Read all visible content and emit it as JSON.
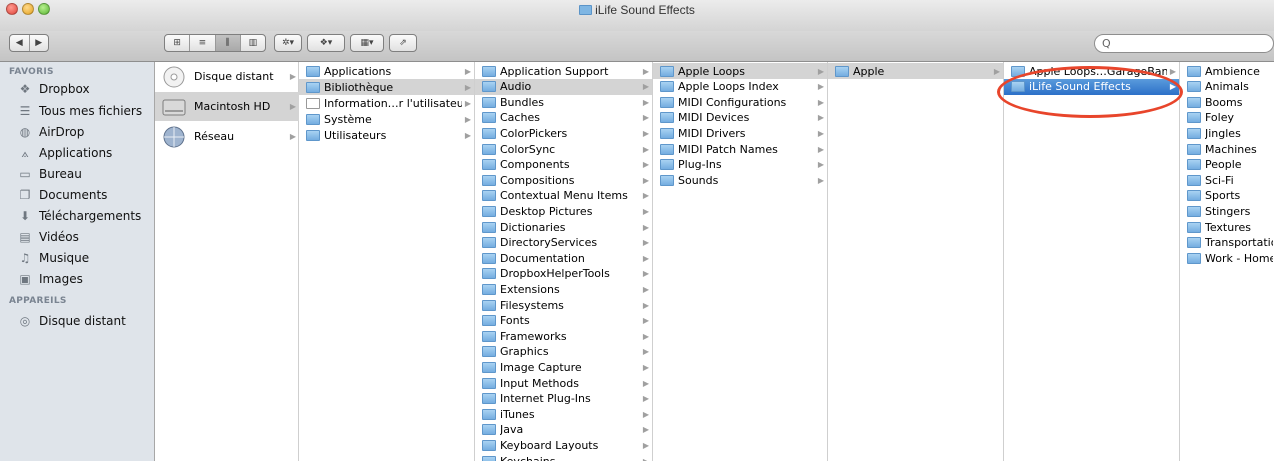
{
  "window": {
    "title": "iLife Sound Effects"
  },
  "toolbar": {
    "search_placeholder": "Q"
  },
  "sidebar": {
    "favorites_header": "FAVORIS",
    "favorites": [
      {
        "label": "Dropbox",
        "icon": "dropbox-icon"
      },
      {
        "label": "Tous mes fichiers",
        "icon": "all-files-icon"
      },
      {
        "label": "AirDrop",
        "icon": "airdrop-icon"
      },
      {
        "label": "Applications",
        "icon": "applications-icon"
      },
      {
        "label": "Bureau",
        "icon": "desktop-icon"
      },
      {
        "label": "Documents",
        "icon": "documents-icon"
      },
      {
        "label": "Téléchargements",
        "icon": "downloads-icon"
      },
      {
        "label": "Vidéos",
        "icon": "movies-icon"
      },
      {
        "label": "Musique",
        "icon": "music-icon"
      },
      {
        "label": "Images",
        "icon": "pictures-icon"
      }
    ],
    "devices_header": "APPAREILS",
    "devices": [
      {
        "label": "Disque distant",
        "icon": "remote-disc-icon"
      }
    ]
  },
  "columns": {
    "col1": [
      {
        "label": "Disque distant",
        "icon": "remote-disc-icon"
      },
      {
        "label": "Macintosh HD",
        "icon": "hard-drive-icon",
        "selected": true
      },
      {
        "label": "Réseau",
        "icon": "network-icon"
      }
    ],
    "col2": [
      {
        "label": "Applications"
      },
      {
        "label": "Bibliothèque",
        "selected": true
      },
      {
        "label": "Information…r l'utilisateur"
      },
      {
        "label": "Système"
      },
      {
        "label": "Utilisateurs"
      }
    ],
    "col3": [
      "Application Support",
      "Audio",
      "Bundles",
      "Caches",
      "ColorPickers",
      "ColorSync",
      "Components",
      "Compositions",
      "Contextual Menu Items",
      "Desktop Pictures",
      "Dictionaries",
      "DirectoryServices",
      "Documentation",
      "DropboxHelperTools",
      "Extensions",
      "Filesystems",
      "Fonts",
      "Frameworks",
      "Graphics",
      "Image Capture",
      "Input Methods",
      "Internet Plug-Ins",
      "iTunes",
      "Java",
      "Keyboard Layouts",
      "Keychains"
    ],
    "col3_selected": "Audio",
    "col4": [
      "Apple Loops",
      "Apple Loops Index",
      "MIDI Configurations",
      "MIDI Devices",
      "MIDI Drivers",
      "MIDI Patch Names",
      "Plug-Ins",
      "Sounds"
    ],
    "col4_selected": "Apple Loops",
    "col5": [
      "Apple"
    ],
    "col5_selected": "Apple",
    "col6": [
      "Apple Loops…GarageBand",
      "iLife Sound Effects"
    ],
    "col6_selected": "iLife Sound Effects",
    "col7": [
      "Ambience",
      "Animals",
      "Booms",
      "Foley",
      "Jingles",
      "Machines",
      "People",
      "Sci-Fi",
      "Sports",
      "Stingers",
      "Textures",
      "Transportation",
      "Work - Home"
    ]
  },
  "colors": {
    "selection_blue": "#2c70c8",
    "selection_gray": "#d4d4d4",
    "annotation_red": "#e8452b",
    "sidebar_bg": "#dfe4ea"
  }
}
